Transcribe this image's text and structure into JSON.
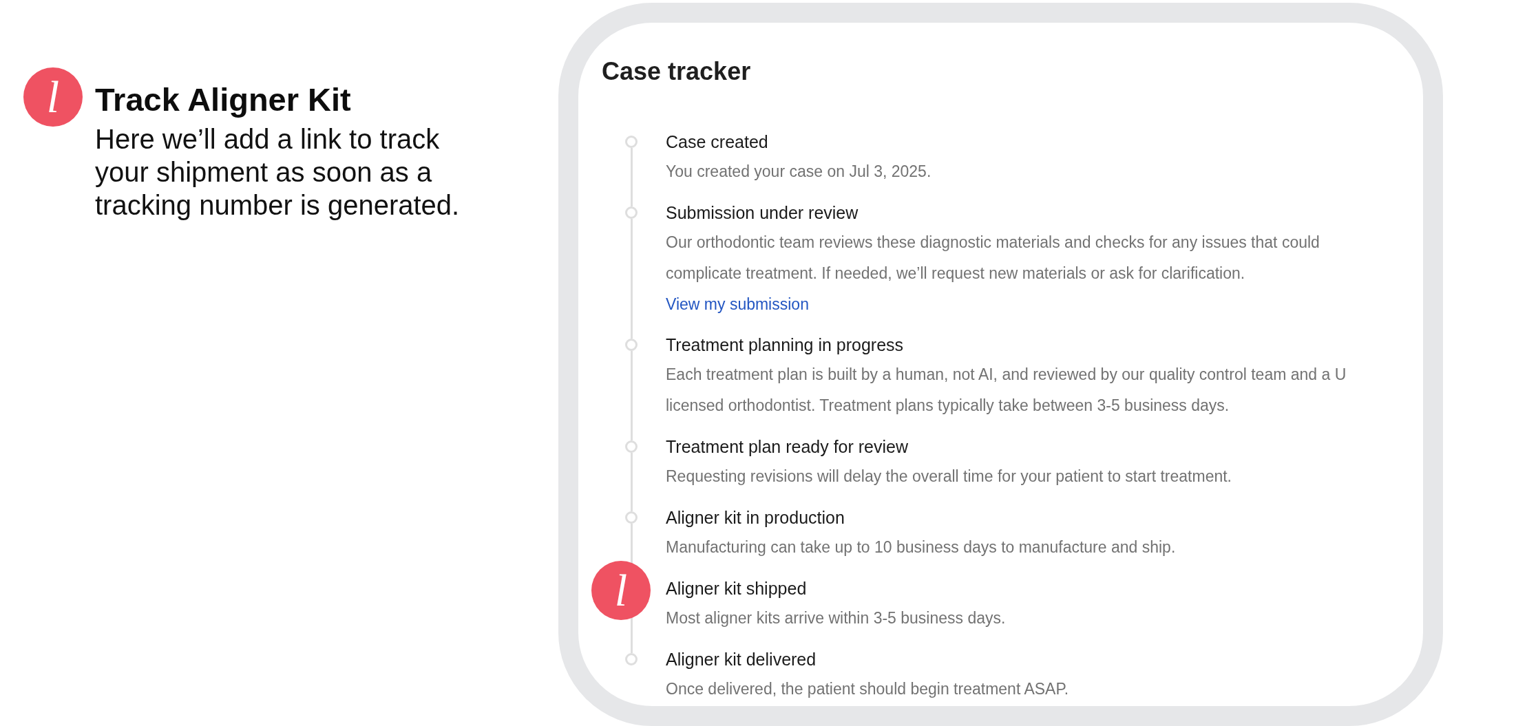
{
  "callout": {
    "marker": "l",
    "title": "Track Aligner Kit",
    "body": "Here we’ll add a link to track\nyour shipment as soon as a\ntracking number is generated."
  },
  "case_tracker": {
    "title": "Case tracker",
    "steps": [
      {
        "title": "Case created",
        "description": "You created your case on Jul 3, 2025."
      },
      {
        "title": "Submission under review",
        "description": "Our orthodontic team reviews these diagnostic materials and checks for any issues that could\ncomplicate treatment. If needed, we’ll request new materials or ask for clarification.",
        "link": "View my submission"
      },
      {
        "title": "Treatment planning in progress",
        "description": "Each treatment plan is built by a human, not AI, and reviewed by our quality control team and a U\nlicensed orthodontist. Treatment plans typically take between 3-5 business days."
      },
      {
        "title": "Treatment plan ready for review",
        "description": "Requesting revisions will delay the overall time for your patient to start treatment."
      },
      {
        "title": "Aligner kit in production",
        "description": "Manufacturing can take up to 10 business days to manufacture and ship."
      },
      {
        "title": "Aligner kit shipped",
        "description": "Most aligner kits arrive within 3-5 business days.",
        "marker": "l"
      },
      {
        "title": "Aligner kit delivered",
        "description": "Once delivered, the patient should begin treatment ASAP."
      }
    ]
  }
}
